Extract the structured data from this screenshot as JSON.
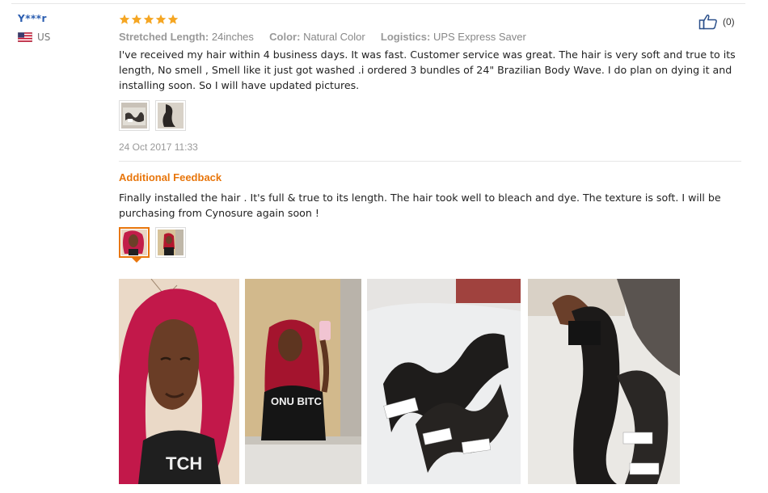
{
  "reviewer": {
    "name": "Y***r",
    "country": "US",
    "flag_icon": "us-flag-icon"
  },
  "review": {
    "rating": 5,
    "star_color": "#f5a623",
    "attributes": [
      {
        "label": "Stretched Length:",
        "value": "24inches"
      },
      {
        "label": "Color:",
        "value": "Natural Color"
      },
      {
        "label": "Logistics:",
        "value": "UPS Express Saver"
      }
    ],
    "text": "I've received my hair within 4 business days. It was fast. Customer service was great. The hair is very soft and true to its length, No smell , Smell like it just got washed .i ordered 3 bundles of 24\" Brazilian Body Wave. I do plan on dying it and installing soon. So I will have updated pictures.",
    "photo_thumbnails": [
      "hair-bundles-photo",
      "hair-bundle-dark-photo"
    ],
    "date": "24 Oct 2017 11:33"
  },
  "helpful": {
    "count": "(0)",
    "icon": "thumbs-up-icon"
  },
  "additional_feedback": {
    "title": "Additional Feedback",
    "text": "Finally installed the hair . It's full & true to its length. The hair took well to bleach and dye. The texture is soft. I will be purchasing from Cynosure again soon !",
    "photo_thumbnails": [
      "red-hair-selfie-photo",
      "red-hair-mirror-photo"
    ],
    "selected_thumbnail": 0,
    "accent_color": "#e8760c"
  },
  "gallery": [
    "red-hair-selfie-photo",
    "red-hair-mirror-selfie-photo",
    "hair-bundles-packaged-photo",
    "hair-bundle-held-photo"
  ]
}
